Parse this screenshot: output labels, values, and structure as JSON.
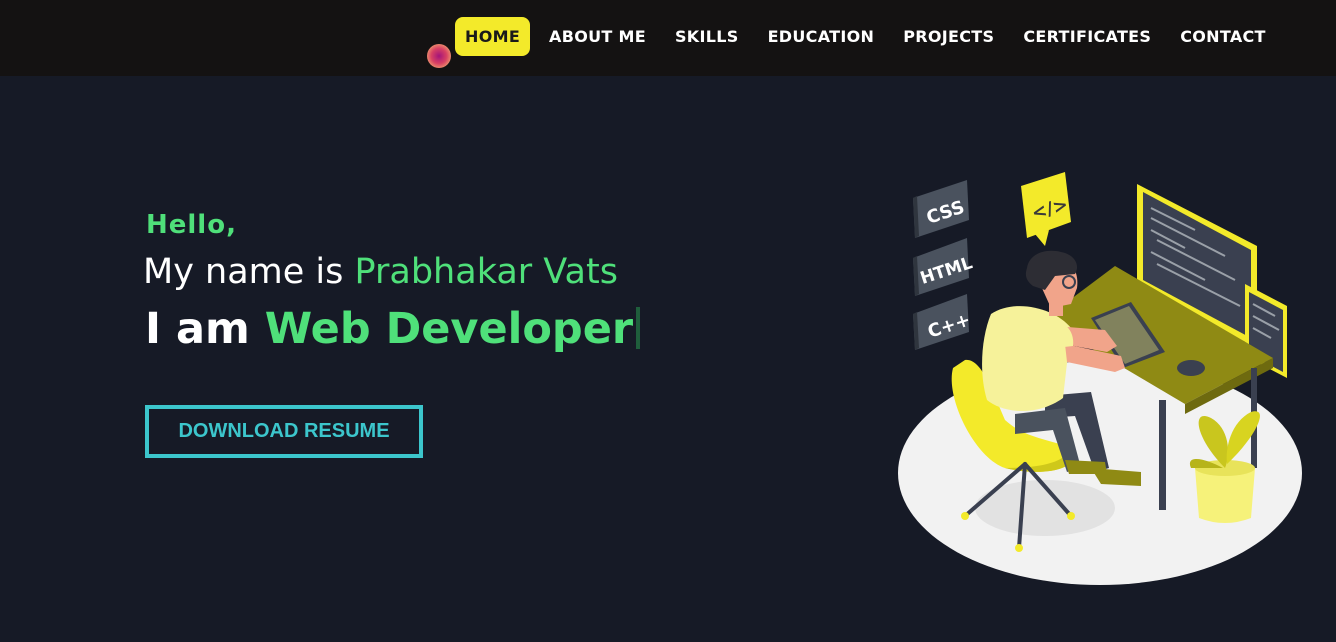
{
  "nav": {
    "items": [
      {
        "label": "HOME",
        "active": true
      },
      {
        "label": "ABOUT ME"
      },
      {
        "label": "SKILLS"
      },
      {
        "label": "EDUCATION"
      },
      {
        "label": "PROJECTS"
      },
      {
        "label": "CERTIFICATES"
      },
      {
        "label": "CONTACT"
      }
    ]
  },
  "hero": {
    "greeting": "Hello,",
    "intro_prefix": "My name is ",
    "name": "Prabhakar Vats",
    "role_prefix": "I am ",
    "role": "Web Developer",
    "resume_button": "DOWNLOAD RESUME"
  },
  "illustration": {
    "tags": [
      "CSS",
      "HTML",
      "C++"
    ],
    "code_bubble": "</>"
  },
  "colors": {
    "background": "#161a26",
    "navbar": "#141212",
    "accent_green": "#4fe07a",
    "accent_yellow": "#f3ea2a",
    "button_cyan": "#3cc6cc"
  }
}
